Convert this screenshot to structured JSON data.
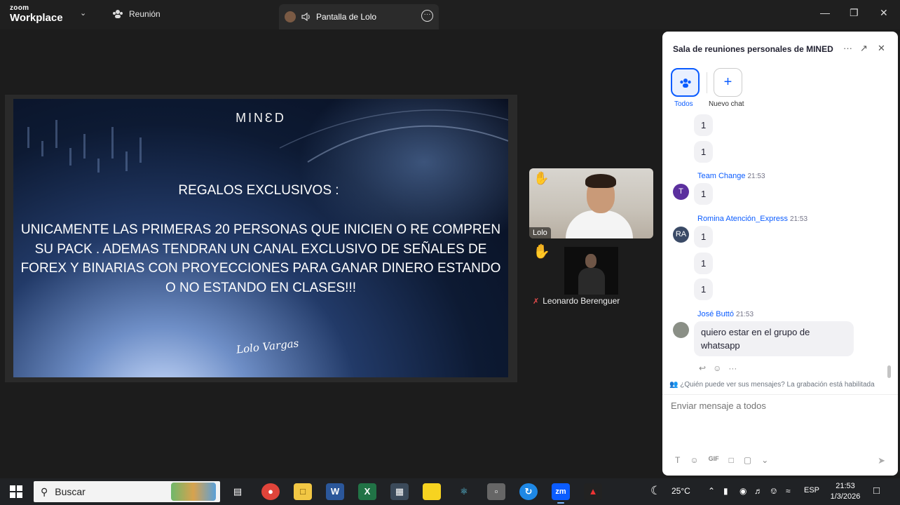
{
  "titlebar": {
    "brand_top": "zoom",
    "brand_bottom": "Workplace",
    "meeting_tab": "Reunión",
    "share_tab": "Pantalla de Lolo"
  },
  "slide": {
    "logo": "MINƐD",
    "title": "REGALOS EXCLUSIVOS :",
    "body_lines": [
      "UNICAMENTE LAS PRIMERAS 20 PERSONAS QUE INICIEN O RE COMPREN",
      "SU PACK . ADEMAS TENDRAN  UN CANAL EXCLUSIVO DE SEÑALES DE",
      "FOREX Y BINARIAS CON PROYECCIONES PARA GANAR DINERO ESTANDO",
      "O NO ESTANDO EN CLASES!!!"
    ],
    "signature": "Lolo Vargas"
  },
  "participants": {
    "speaker_name": "Lolo",
    "other_name": "Leonardo Berenguer"
  },
  "chat": {
    "title": "Sala de reuniones personales de MINED",
    "tab_all": "Todos",
    "tab_new": "Nuevo chat",
    "messages": {
      "m1": "1",
      "m2": "1",
      "team_avatar": "T",
      "team_sender": "Team Change",
      "team_time": "21:53",
      "m3": "1",
      "romina_avatar": "RA",
      "romina_sender": "Romina Atención_Express",
      "romina_time": "21:53",
      "m4": "1",
      "m5": "1",
      "m6": "1",
      "jose_sender": "José Buttó",
      "jose_time": "21:53",
      "jose_text": "quiero estar en el grupo de whatsapp"
    },
    "privacy_notice": "¿Quién puede ver sus mensajes? La grabación está habilitada",
    "input_placeholder": "Enviar mensaje a todos"
  },
  "taskbar": {
    "search_label": "Buscar",
    "temperature": "25°C",
    "language": "ESP",
    "time": "21:53",
    "date": "1/3/2026"
  },
  "colors": {
    "accent": "#0b5cff",
    "team_avatar": "#5b2f9e",
    "romina_avatar": "#3a4a66"
  }
}
